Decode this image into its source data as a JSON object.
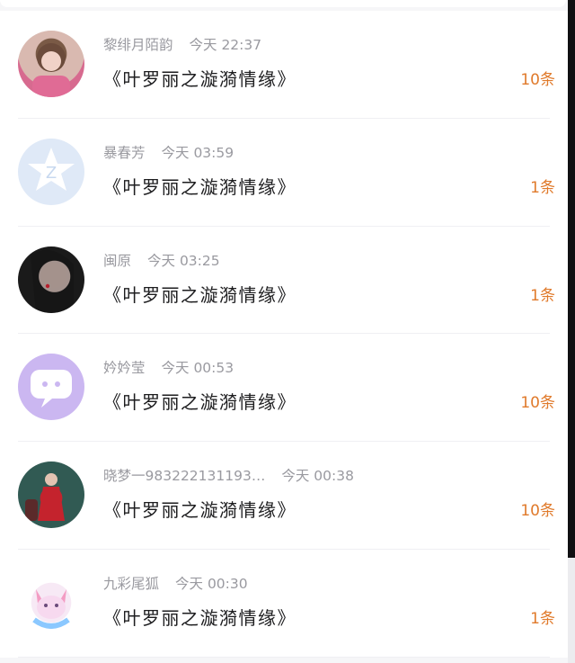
{
  "rows": [
    {
      "avatar": "girl-pink-avatar",
      "name": "黎绯月陌韵",
      "time": "今天 22:37",
      "message": "《叶罗丽之漩漪情缘》",
      "count": "10条"
    },
    {
      "avatar": "qq-logo-avatar",
      "name": "暴春芳",
      "time": "今天 03:59",
      "message": "《叶罗丽之漩漪情缘》",
      "count": "1条"
    },
    {
      "avatar": "woman-black-hair-avatar",
      "name": "闽原",
      "time": "今天 03:25",
      "message": "《叶罗丽之漩漪情缘》",
      "count": "1条"
    },
    {
      "avatar": "chat-bubble-avatar",
      "name": "妗妗莹",
      "time": "今天 00:53",
      "message": "《叶罗丽之漩漪情缘》",
      "count": "10条"
    },
    {
      "avatar": "woman-red-dress-avatar",
      "name": "晓梦一983222131193…",
      "time": "今天 00:38",
      "message": "《叶罗丽之漩漪情缘》",
      "count": "10条"
    },
    {
      "avatar": "fox-avatar",
      "name": "九彩尾狐",
      "time": "今天 00:30",
      "message": "《叶罗丽之漩漪情缘》",
      "count": "1条"
    }
  ],
  "colors": {
    "count": "#e07a2b",
    "meta": "#9a9aa0",
    "text": "#1d1d1f"
  }
}
